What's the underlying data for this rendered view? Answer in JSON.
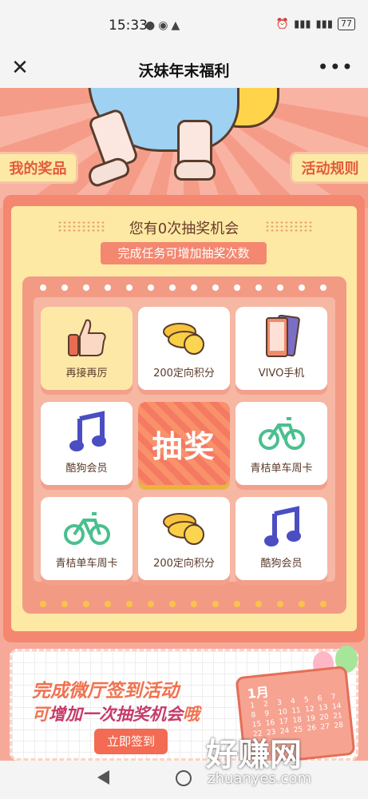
{
  "status_bar": {
    "time": "15:33",
    "battery": "77"
  },
  "nav": {
    "title": "沃妹年末福利"
  },
  "side": {
    "prizes": "我的奖品",
    "rules": "活动规则"
  },
  "lottery": {
    "chances": "您有0次抽奖机会",
    "tip": "完成任务可增加抽奖次数",
    "draw_label": "抽奖",
    "prizes": [
      {
        "label": "再接再厉",
        "icon": "thumbs-up-icon"
      },
      {
        "label": "200定向积分",
        "icon": "coins-icon"
      },
      {
        "label": "VIVO手机",
        "icon": "phone-icon"
      },
      {
        "label": "酷狗会员",
        "icon": "music-note-icon"
      },
      {
        "label": "青桔单车周卡",
        "icon": "bicycle-icon"
      },
      {
        "label": "青桔单车周卡",
        "icon": "bicycle-icon"
      },
      {
        "label": "200定向积分",
        "icon": "coins-icon"
      },
      {
        "label": "酷狗会员",
        "icon": "music-note-icon"
      }
    ]
  },
  "banner": {
    "line1": "完成微厅签到活动",
    "line2_a": "可",
    "line2_b": "增加一次抽奖机会",
    "line2_c": "哦",
    "button": "立即签到",
    "calendar_title": "1月"
  },
  "watermark": {
    "main": "好赚网",
    "sub": "zhuanyes.com"
  },
  "colors": {
    "accent": "#f4876f",
    "panel": "#fde9a4",
    "text_red": "#e25b3c"
  }
}
